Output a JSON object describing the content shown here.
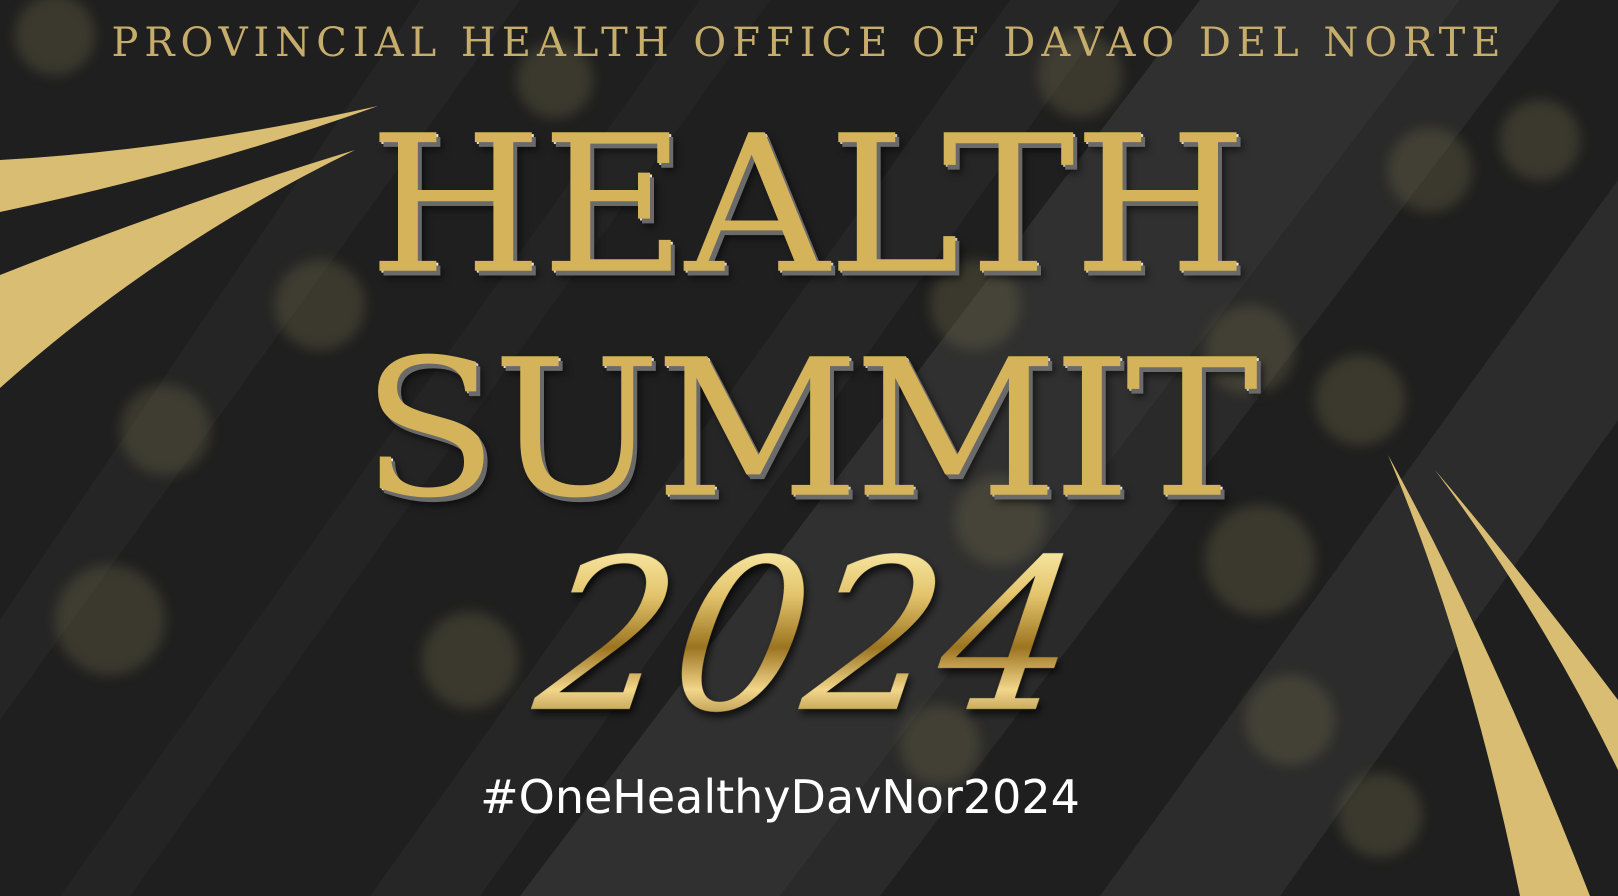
{
  "header": {
    "organization": "PROVINCIAL HEALTH OFFICE OF DAVAO DEL NORTE"
  },
  "title": {
    "line1": "HEALTH",
    "line2": "SUMMIT",
    "year": "2024"
  },
  "hashtag": "#OneHealthyDavNor2024",
  "colors": {
    "background": "#1e1e1e",
    "gold": "#d9bd72",
    "org_text": "#c7ad6c",
    "hashtag_text": "#ffffff"
  }
}
